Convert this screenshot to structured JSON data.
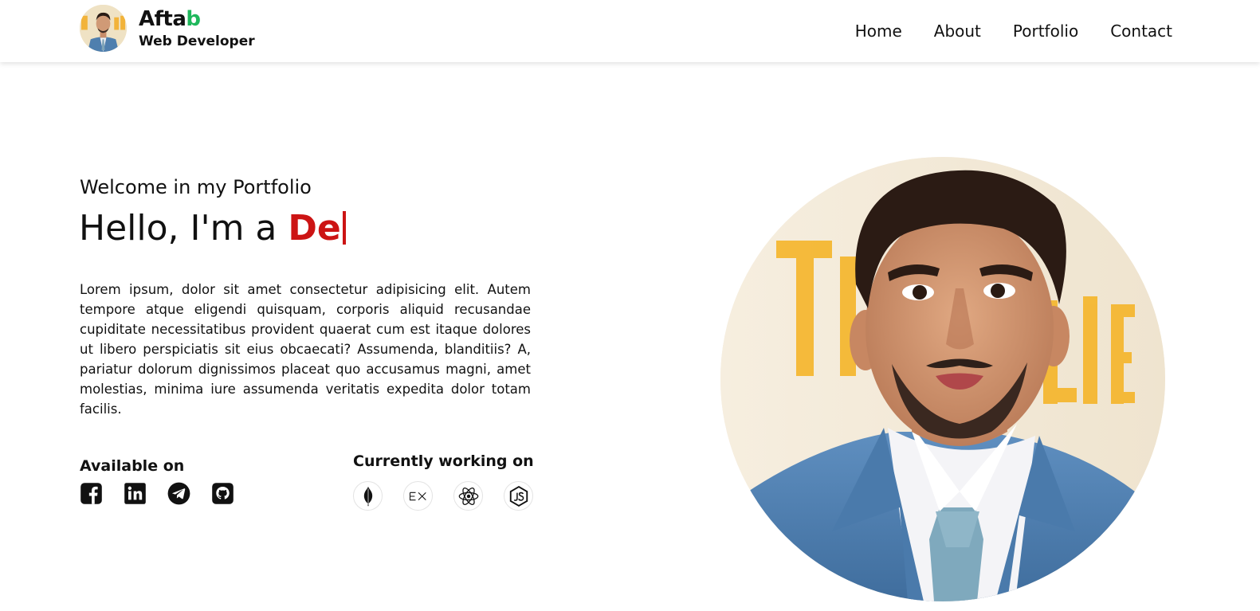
{
  "header": {
    "brand_name_main": "Afta",
    "brand_name_accent": "b",
    "brand_role": "Web Developer",
    "nav": [
      {
        "label": "Home"
      },
      {
        "label": "About"
      },
      {
        "label": "Portfolio"
      },
      {
        "label": "Contact"
      }
    ]
  },
  "hero": {
    "welcome": "Welcome in my Portfolio",
    "hello_prefix": "Hello, I'm a ",
    "typed_text": "De",
    "description": "Lorem ipsum, dolor sit amet consectetur adipisicing elit. Autem tempore atque eligendi quisquam, corporis aliquid recusandae cupiditate necessitatibus provident quaerat cum est itaque dolores ut libero perspiciatis sit eius obcaecati? Assumenda, blanditiis? A, pariatur dolorum dignissimos placeat quo accusamus magni, amet molestias, minima iure assumenda veritatis expedita dolor totam facilis."
  },
  "available": {
    "title": "Available on",
    "icons": [
      "facebook-icon",
      "linkedin-icon",
      "telegram-icon",
      "github-icon"
    ]
  },
  "working": {
    "title": "Currently working on",
    "icons": [
      "mongodb-icon",
      "express-icon",
      "react-icon",
      "nodejs-icon"
    ]
  },
  "colors": {
    "accent_green": "#1fb85c",
    "typed_red": "#cc1414",
    "text": "#111111"
  }
}
